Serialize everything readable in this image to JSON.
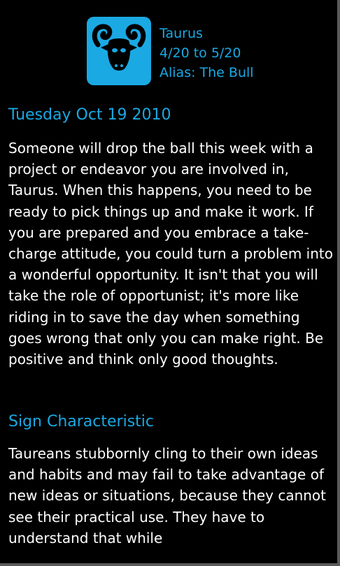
{
  "sign": {
    "name": "Taurus",
    "dates": "4/20 to 5/20",
    "alias": "Alias: The Bull",
    "icon": "bull-icon"
  },
  "horoscope": {
    "date": "Tuesday Oct 19 2010",
    "text": "Someone will drop the ball this week with a project or endeavor you are involved in, Taurus. When this happens, you need to be ready to pick things up and make it work. If you are prepared and you embrace a take-charge attitude, you could turn a problem into a wonderful opportunity. It isn't that you will take the role of opportunist; it's more like riding in to save the day when something goes wrong that only you can make right. Be positive and think only good thoughts."
  },
  "characteristic": {
    "title": "Sign Characteristic",
    "text": "Taureans stubbornly cling to their own ideas and habits and may fail to take advantage of new ideas or situations, because they cannot see their practical use. They have to understand that while"
  },
  "colors": {
    "accent": "#1aa9e3",
    "background": "#000000",
    "text": "#ffffff"
  }
}
